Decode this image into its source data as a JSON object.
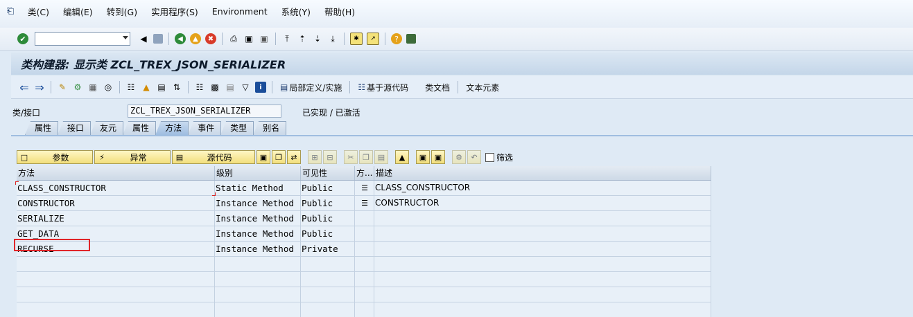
{
  "menubar": {
    "items": [
      "类(C)",
      "编辑(E)",
      "转到(G)",
      "实用程序(S)",
      "Environment",
      "系统(Y)",
      "帮助(H)"
    ]
  },
  "toolbar": {
    "icons": [
      "enter-icon",
      "back-icon",
      "save-icon",
      "back-nav-icon",
      "exit-icon",
      "cancel-icon",
      "print-icon",
      "find-icon",
      "find-next-icon",
      "first-page-icon",
      "prev-page-icon",
      "next-page-icon",
      "last-page-icon",
      "new-session-icon",
      "shortcut-icon",
      "help-icon",
      "layout-icon"
    ]
  },
  "title": "类构建器: 显示类 ZCL_TREX_JSON_SERIALIZER",
  "app_toolbar": {
    "local_def": "局部定义/实施",
    "based_on_source": "基于源代码",
    "class_doc": "类文档",
    "text_elements": "文本元素"
  },
  "class_row": {
    "label": "类/接口",
    "value": "ZCL_TREX_JSON_SERIALIZER",
    "status": "已实现 / 已激活"
  },
  "tabs": [
    "属性",
    "接口",
    "友元",
    "属性",
    "方法",
    "事件",
    "类型",
    "别名"
  ],
  "active_tab": "方法",
  "subtoolbar": {
    "params": "参数",
    "exceptions": "异常",
    "source": "源代码",
    "filter": "筛选"
  },
  "grid": {
    "headers": [
      "方法",
      "级别",
      "可见性",
      "方...",
      "描述"
    ],
    "rows": [
      {
        "method": "CLASS_CONSTRUCTOR",
        "level": "Static Method",
        "visibility": "Public",
        "type_icon": "method-type-icon",
        "desc": "CLASS_CONSTRUCTOR"
      },
      {
        "method": "CONSTRUCTOR",
        "level": "Instance Method",
        "visibility": "Public",
        "type_icon": "method-type-icon",
        "desc": "CONSTRUCTOR"
      },
      {
        "method": "SERIALIZE",
        "level": "Instance Method",
        "visibility": "Public",
        "type_icon": "",
        "desc": ""
      },
      {
        "method": "GET_DATA",
        "level": "Instance Method",
        "visibility": "Public",
        "type_icon": "",
        "desc": ""
      },
      {
        "method": "RECURSE",
        "level": "Instance Method",
        "visibility": "Private",
        "type_icon": "",
        "desc": ""
      }
    ]
  }
}
